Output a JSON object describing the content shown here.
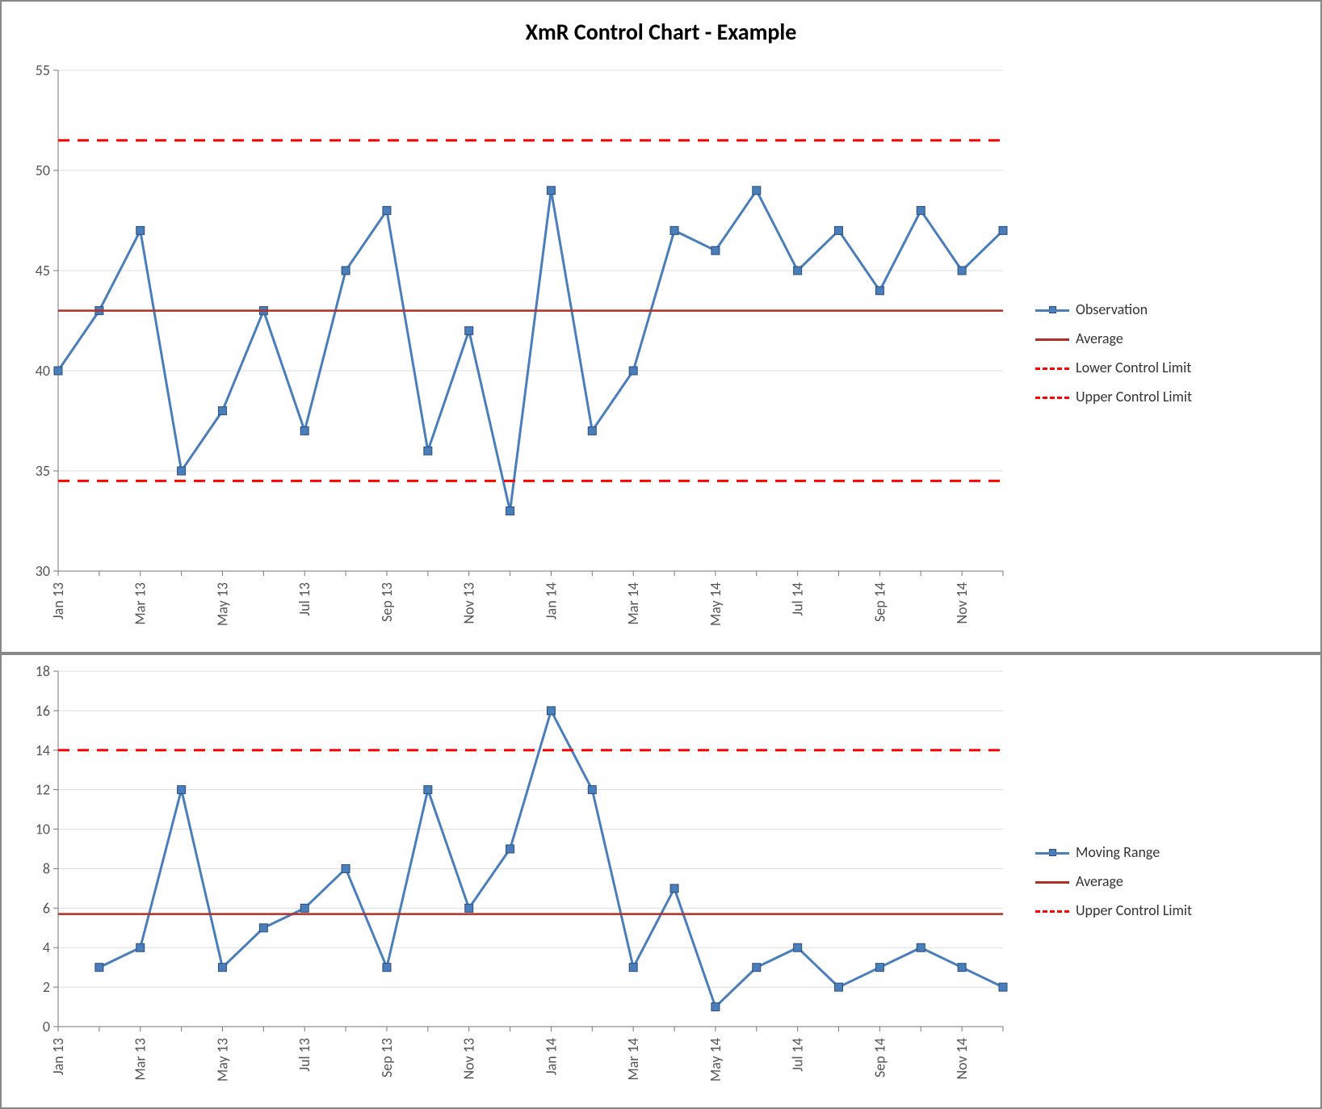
{
  "title": "XmR Control Chart - Example",
  "legend_top": {
    "observation": "Observation",
    "average": "Average",
    "lcl": "Lower Control Limit",
    "ucl": "Upper Control Limit"
  },
  "legend_bottom": {
    "moving_range": "Moving Range",
    "average": "Average",
    "ucl": "Upper Control Limit"
  },
  "chart_data": [
    {
      "type": "line",
      "title": "XmR Control Chart - Example (Individuals)",
      "categories": [
        "Jan 13",
        "Feb 13",
        "Mar 13",
        "Apr 13",
        "May 13",
        "Jun 13",
        "Jul 13",
        "Aug 13",
        "Sep 13",
        "Oct 13",
        "Nov 13",
        "Dec 13",
        "Jan 14",
        "Feb 14",
        "Mar 14",
        "Apr 14",
        "May 14",
        "Jun 14",
        "Jul 14",
        "Aug 14",
        "Sep 14",
        "Oct 14",
        "Nov 14",
        "Dec 14"
      ],
      "x_tick_labels": [
        "Jan 13",
        "Mar 13",
        "May 13",
        "Jul 13",
        "Sep 13",
        "Nov 13",
        "Jan 14",
        "Mar 14",
        "May 14",
        "Jul 14",
        "Sep 14",
        "Nov 14"
      ],
      "series": [
        {
          "name": "Observation",
          "values": [
            40,
            43,
            47,
            35,
            38,
            43,
            37,
            45,
            48,
            36,
            42,
            33,
            49,
            37,
            40,
            47,
            46,
            49,
            45,
            47,
            44,
            48,
            45,
            47
          ],
          "style": "line-markers",
          "color": "#4A7EBB"
        },
        {
          "name": "Average",
          "values": 43,
          "style": "solid",
          "color": "#b03026"
        },
        {
          "name": "Lower Control Limit",
          "values": 34.5,
          "style": "dashed",
          "color": "#ff0000"
        },
        {
          "name": "Upper Control Limit",
          "values": 51.5,
          "style": "dashed",
          "color": "#ff0000"
        }
      ],
      "ylim": [
        30,
        55
      ],
      "y_ticks": [
        30,
        35,
        40,
        45,
        50,
        55
      ],
      "xlabel": "",
      "ylabel": "",
      "grid": true,
      "legend_position": "right"
    },
    {
      "type": "line",
      "title": "",
      "categories": [
        "Jan 13",
        "Feb 13",
        "Mar 13",
        "Apr 13",
        "May 13",
        "Jun 13",
        "Jul 13",
        "Aug 13",
        "Sep 13",
        "Oct 13",
        "Nov 13",
        "Dec 13",
        "Jan 14",
        "Feb 14",
        "Mar 14",
        "Apr 14",
        "May 14",
        "Jun 14",
        "Jul 14",
        "Aug 14",
        "Sep 14",
        "Oct 14",
        "Nov 14",
        "Dec 14"
      ],
      "x_tick_labels": [
        "Jan 13",
        "Mar 13",
        "May 13",
        "Jul 13",
        "Sep 13",
        "Nov 13",
        "Jan 14",
        "Mar 14",
        "May 14",
        "Jul 14",
        "Sep 14",
        "Nov 14"
      ],
      "series": [
        {
          "name": "Moving Range",
          "values": [
            null,
            3,
            4,
            12,
            3,
            5,
            6,
            8,
            3,
            12,
            6,
            9,
            16,
            12,
            3,
            7,
            1,
            3,
            4,
            2,
            3,
            4,
            3,
            2
          ],
          "style": "line-markers",
          "color": "#4A7EBB"
        },
        {
          "name": "Average",
          "values": 5.7,
          "style": "solid",
          "color": "#b03026"
        },
        {
          "name": "Upper Control Limit",
          "values": 14,
          "style": "dashed",
          "color": "#ff0000"
        }
      ],
      "ylim": [
        0,
        18
      ],
      "y_ticks": [
        0,
        2,
        4,
        6,
        8,
        10,
        12,
        14,
        16,
        18
      ],
      "xlabel": "",
      "ylabel": "",
      "grid": true,
      "legend_position": "right"
    }
  ]
}
